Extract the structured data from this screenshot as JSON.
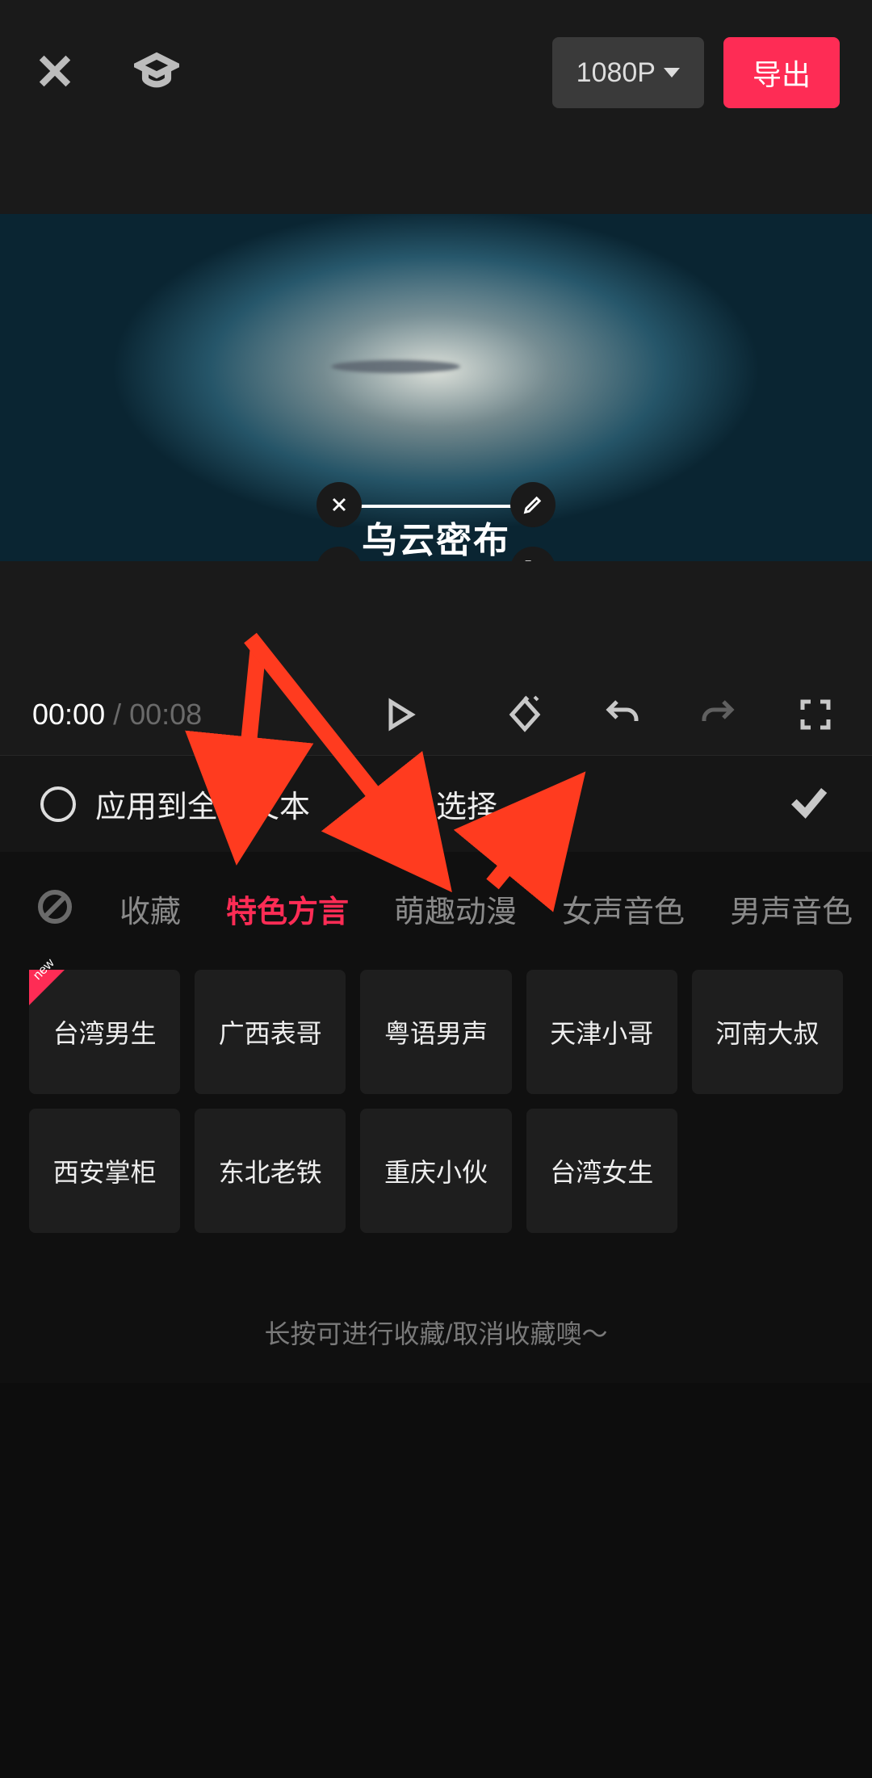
{
  "header": {
    "resolution_label": "1080P",
    "export_label": "导出"
  },
  "preview": {
    "caption_text": "乌云密布"
  },
  "transport": {
    "current_time": "00:00",
    "separator": " / ",
    "duration": "00:08"
  },
  "panel": {
    "apply_all_label": "应用到全部文本",
    "title": "音色选择"
  },
  "tabs": {
    "favorites": "收藏",
    "dialect": "特色方言",
    "anime": "萌趣动漫",
    "female": "女声音色",
    "male": "男声音色"
  },
  "voices": {
    "row1": {
      "v0": "台湾男生",
      "v1": "广西表哥",
      "v2": "粤语男声",
      "v3": "天津小哥",
      "v4": "河南大叔"
    },
    "row2": {
      "v0": "西安掌柜",
      "v1": "东北老铁",
      "v2": "重庆小伙",
      "v3": "台湾女生"
    }
  },
  "hint_text": "长按可进行收藏/取消收藏噢～",
  "colors": {
    "accent": "#fe2c55"
  }
}
